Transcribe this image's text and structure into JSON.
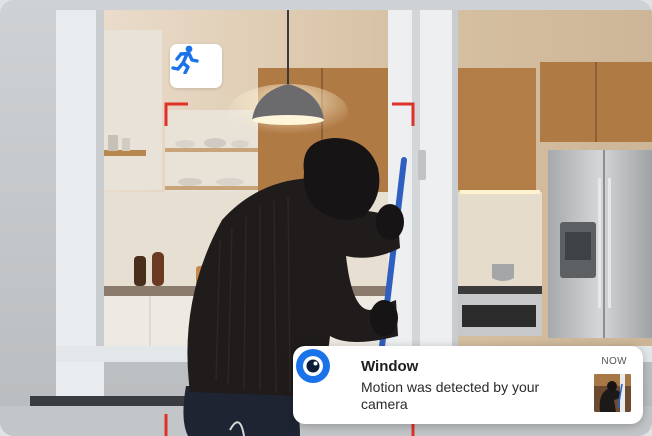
{
  "motion_badge": {
    "icon": "running-person-icon",
    "color": "#1a73e8"
  },
  "notification": {
    "app_icon": "camera-lens-icon",
    "title": "Window",
    "body": "Motion was detected by your camera",
    "time": "NOW",
    "thumbnail": "intruder-thumbnail"
  },
  "colors": {
    "accent": "#1a73e8",
    "detection_frame": "#e0302a",
    "window_frame": "#e9ecee",
    "intruder": "#1f1c1b",
    "pole": "#2f5fbf"
  }
}
